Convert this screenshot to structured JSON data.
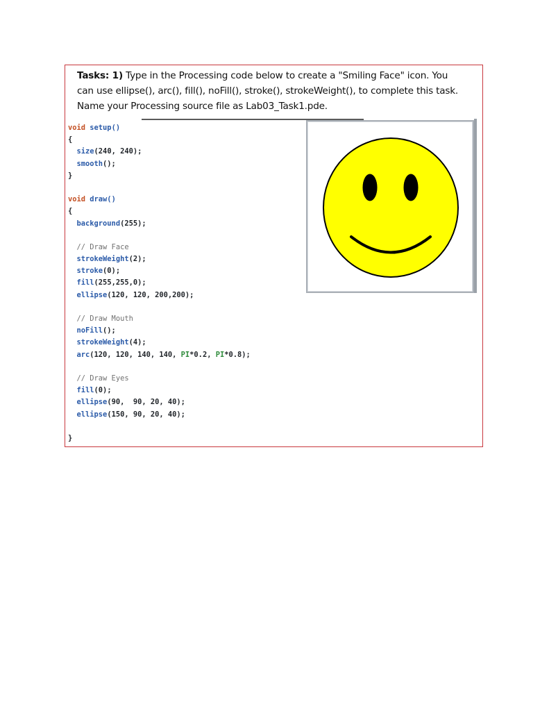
{
  "task": {
    "label": "Tasks: 1)",
    "line1_rest": " Type in the Processing code below to create a \"Smiling Face\" icon. You",
    "line2": "can use ellipse(), arc(), fill(), noFill(), stroke(), strokeWeight(), to complete this task.",
    "line3": "Name your Processing source file as Lab03_Task1.pde."
  },
  "code": {
    "setup_kw": "void",
    "setup_name": " setup()",
    "open1": "{",
    "size_fn": "  size",
    "size_args": "(240, 240);",
    "smooth_fn": "  smooth",
    "smooth_args": "();",
    "close1": "}",
    "draw_kw": "void",
    "draw_name": " draw()",
    "open2": "{",
    "background_fn": "  background",
    "background_args": "(255);",
    "comment_face": "  // Draw Face",
    "sw2_fn": "  strokeWeight",
    "sw2_args": "(2);",
    "stroke_fn": "  stroke",
    "stroke_args": "(0);",
    "fill_fn": "  fill",
    "fill_args": "(255,255,0);",
    "ellipse_face_fn": "  ellipse",
    "ellipse_face_args": "(120, 120, 200,200);",
    "comment_mouth": "  // Draw Mouth",
    "nofill_fn": "  noFill",
    "nofill_args": "();",
    "sw4_fn": "  strokeWeight",
    "sw4_args": "(4);",
    "arc_fn": "  arc",
    "arc_args_a": "(120, 120, 140, 140, ",
    "arc_pi1": "PI",
    "arc_args_b": "*0.2, ",
    "arc_pi2": "PI",
    "arc_args_c": "*0.8);",
    "comment_eyes": "  // Draw Eyes",
    "fill0_fn": "  fill",
    "fill0_args": "(0);",
    "eye1_fn": "  ellipse",
    "eye1_args": "(90,  90, 20, 40);",
    "eye2_fn": "  ellipse",
    "eye2_args": "(150, 90, 20, 40);",
    "close2": "}"
  },
  "colors": {
    "border": "#c8373d",
    "keyword": "#c34f22",
    "function": "#2a5aa8",
    "face_fill": "#ffff00",
    "outline": "#000000"
  }
}
